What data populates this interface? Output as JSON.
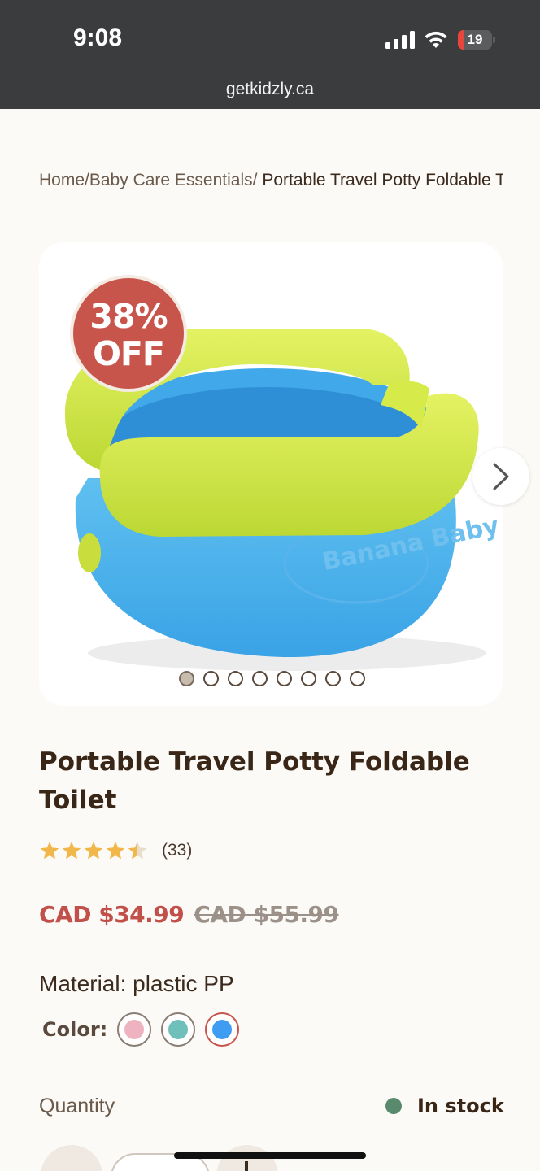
{
  "status_bar": {
    "time": "9:08",
    "battery_level": "19",
    "battery_fraction": 0.19,
    "signal_icon": "cellular-signal-icon",
    "wifi_icon": "wifi-icon",
    "battery_icon": "battery-low-icon"
  },
  "browser": {
    "url": "getkidzly.ca"
  },
  "breadcrumb": {
    "home": "Home",
    "category": "Baby Care Essentials",
    "current": " Portable Travel Potty Foldable Toilet",
    "separator": "/"
  },
  "gallery": {
    "badge": {
      "percent": "38%",
      "label": "OFF"
    },
    "image_caption": "Banana Baby Toilet",
    "next_icon": "chevron-right-icon",
    "slide_count": 8,
    "active_slide": 1
  },
  "product": {
    "title": "Portable Travel Potty Foldable Toilet",
    "rating": 4.5,
    "review_count": "(33)",
    "price_sale": "CAD $34.99",
    "price_regular": "CAD $55.99",
    "material": "Material: plastic PP",
    "color_label": "Color:",
    "colors": [
      {
        "name": "pink",
        "hex": "#efb3bf"
      },
      {
        "name": "teal",
        "hex": "#6fbfbb"
      },
      {
        "name": "blue",
        "hex": "#3f9cf3"
      }
    ],
    "selected_color": 2,
    "quantity_label": "Quantity",
    "stock_text": "In stock"
  },
  "colors": {
    "status_bar_bg": "#3a3c3e",
    "accent_red": "#c8554c",
    "stock_green": "#5a8a6e",
    "star_gold": "#f2b74a",
    "text_brown": "#3a2616"
  }
}
